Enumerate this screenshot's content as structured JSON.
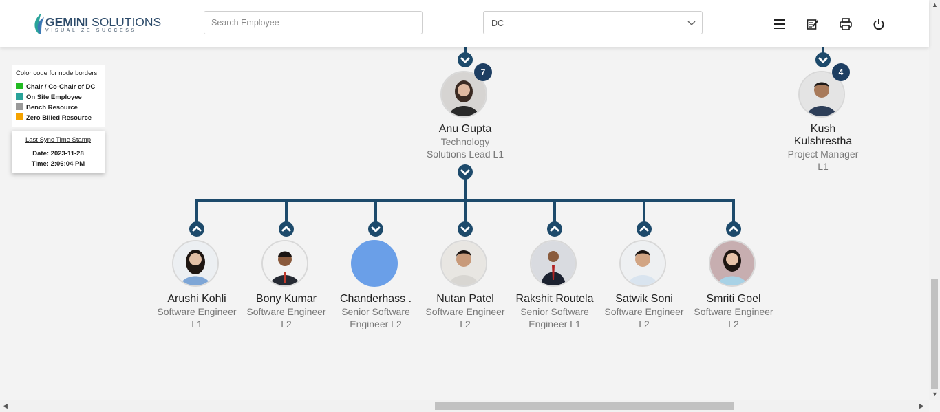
{
  "header": {
    "logo_main_bold": "GEMINI",
    "logo_main_rest": " SOLUTIONS",
    "logo_tagline": "VISUALIZE SUCCESS",
    "search_placeholder": "Search Employee",
    "select_value": "DC",
    "icons": [
      "menu-icon",
      "edit-icon",
      "print-icon",
      "power-icon"
    ]
  },
  "legend": {
    "title": "Color code for node borders",
    "items": [
      {
        "label": "Chair / Co-Chair of DC",
        "color": "#22bb22"
      },
      {
        "label": "On Site Employee",
        "color": "#2aa39a"
      },
      {
        "label": "Bench Resource",
        "color": "#9a9a9a"
      },
      {
        "label": "Zero Billed Resource",
        "color": "#f5a300"
      }
    ]
  },
  "sync": {
    "title": "Last Sync Time Stamp",
    "date": "Date: 2023-11-28",
    "time": "Time: 2:06:04 PM"
  },
  "colors": {
    "connector": "#1d4a6b",
    "badge": "#1d3e62",
    "placeholder_avatar": "#6a9fe8"
  },
  "top_nodes": [
    {
      "name": "Anu Gupta",
      "role_line1": "Technology",
      "role_line2": "Solutions Lead L1",
      "count": "7"
    },
    {
      "name_line1": "Kush",
      "name_line2": "Kulshrestha",
      "role_line1": "Project Manager",
      "role_line2": "L1",
      "count": "4"
    }
  ],
  "children": [
    {
      "name": "Arushi Kohli",
      "role_line1": "Software Engineer",
      "role_line2": "L1"
    },
    {
      "name": "Bony Kumar",
      "role_line1": "Software Engineer",
      "role_line2": "L2"
    },
    {
      "name": "Chanderhass .",
      "role_line1": "Senior Software",
      "role_line2": "Engineer L2"
    },
    {
      "name": "Nutan Patel",
      "role_line1": "Software Engineer",
      "role_line2": "L2"
    },
    {
      "name": "Rakshit Routela",
      "role_line1": "Senior Software",
      "role_line2": "Engineer L1"
    },
    {
      "name": "Satwik Soni",
      "role_line1": "Software Engineer",
      "role_line2": "L2"
    },
    {
      "name": "Smriti Goel",
      "role_line1": "Software Engineer",
      "role_line2": "L2"
    }
  ]
}
